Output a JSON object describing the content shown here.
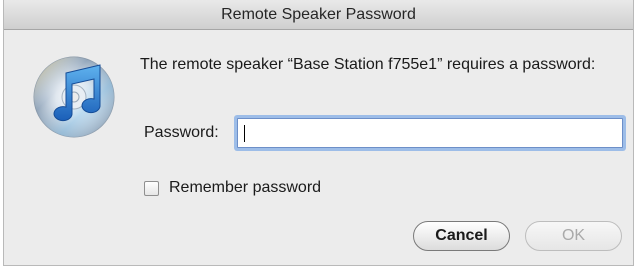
{
  "dialog": {
    "title": "Remote Speaker Password",
    "message": "The remote speaker “Base Station f755e1” requires a password:",
    "icon": "itunes-cd-icon",
    "password_label": "Password:",
    "password_value": "",
    "remember_label": "Remember password",
    "remember_checked": false,
    "cancel_label": "Cancel",
    "ok_label": "OK",
    "ok_enabled": false
  },
  "colors": {
    "window_bg": "#ececec",
    "focus_ring": "#9dbde8",
    "disabled_text": "#a9a9a9"
  }
}
